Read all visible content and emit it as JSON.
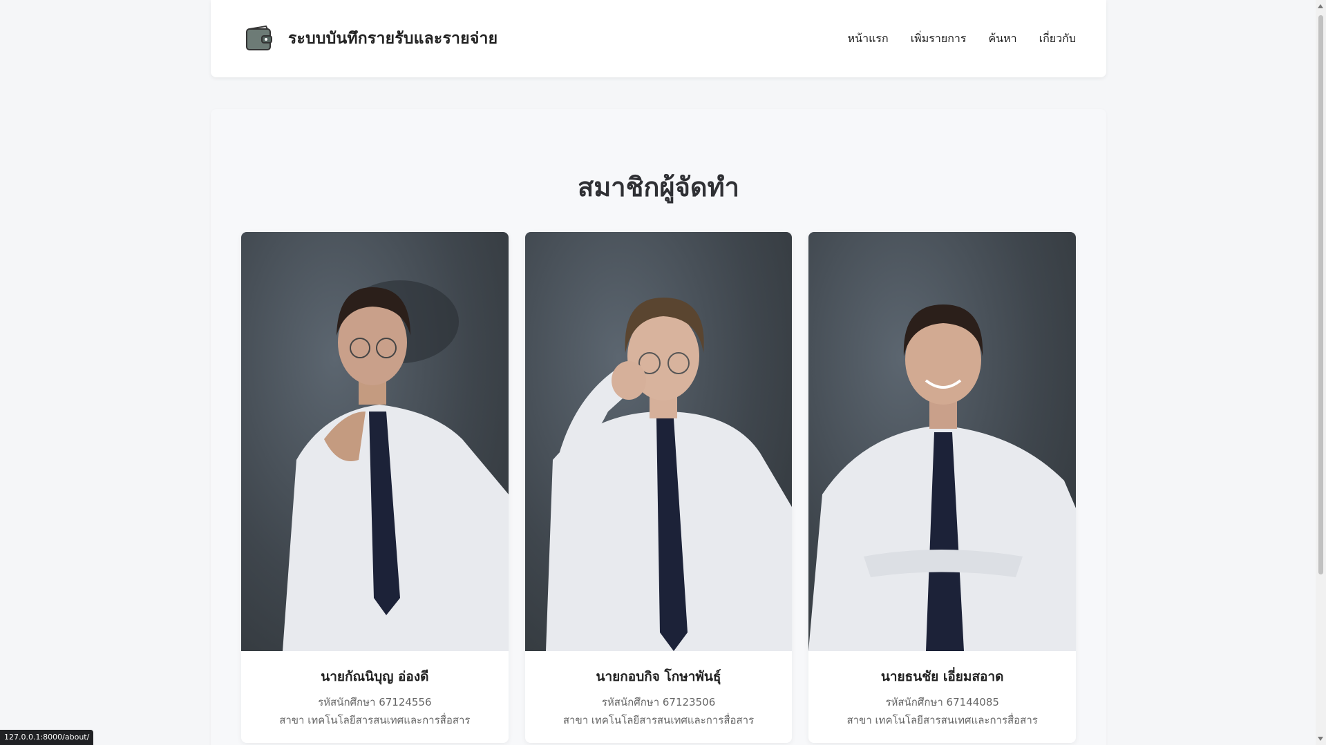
{
  "header": {
    "brand_title": "ระบบบันทึกรายรับและรายจ่าย",
    "brand_icon": "wallet-icon",
    "nav": [
      {
        "label": "หน้าแรก"
      },
      {
        "label": "เพิ่มรายการ"
      },
      {
        "label": "ค้นหา"
      },
      {
        "label": "เกี่ยวกับ"
      }
    ]
  },
  "about": {
    "title": "สมาชิกผู้จัดทำ",
    "members": [
      {
        "name": "นายกัณนิบุญ อ่องดี",
        "student_id": "รหัสนักศึกษา 67124556",
        "major": "สาขา เทคโนโลยีสารสนเทศและการสื่อสาร"
      },
      {
        "name": "นายกอบกิจ โกษาพันธุ์",
        "student_id": "รหัสนักศึกษา 67123506",
        "major": "สาขา เทคโนโลยีสารสนเทศและการสื่อสาร"
      },
      {
        "name": "นายธนชัย เอี่ยมสอาด",
        "student_id": "รหัสนักศึกษา 67144085",
        "major": "สาขา เทคโนโลยีสารสนเทศและการสื่อสาร"
      }
    ]
  },
  "status_bar": {
    "url": "127.0.0.1:8000/about/"
  },
  "colors": {
    "background": "#f5f6f8",
    "card": "#ffffff",
    "photo_backdrop": "#3f464d",
    "tie": "#1c2238"
  }
}
